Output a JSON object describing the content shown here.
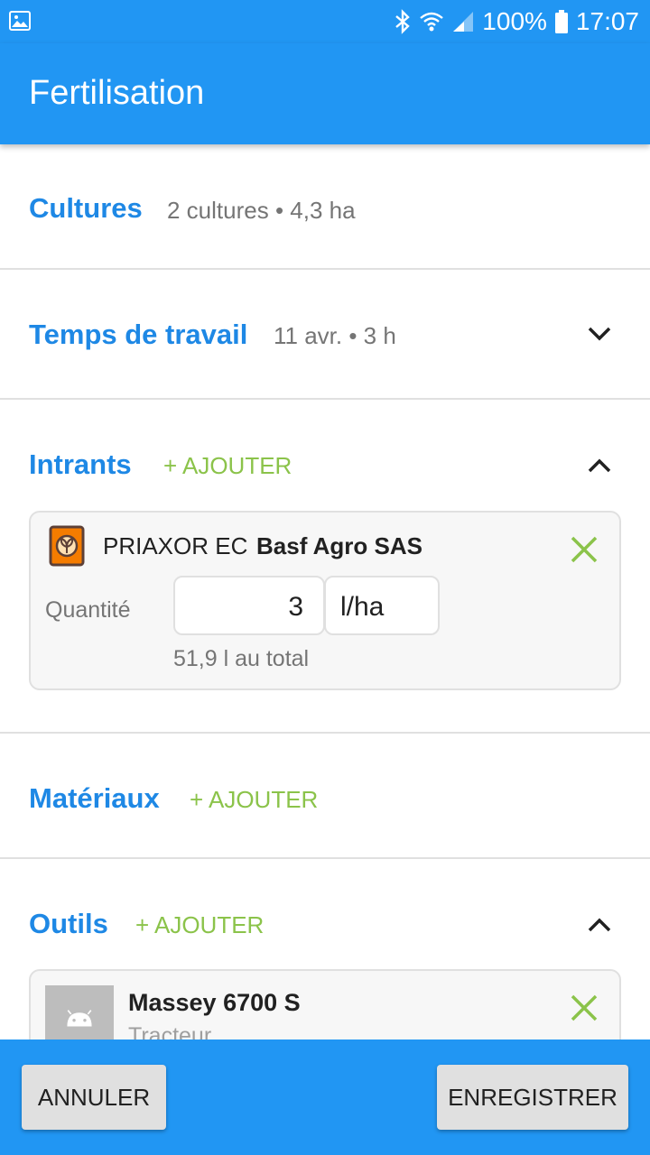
{
  "status_bar": {
    "battery": "100%",
    "time": "17:07"
  },
  "app_bar": {
    "title": "Fertilisation"
  },
  "cultures": {
    "title": "Cultures",
    "summary": "2 cultures • 4,3 ha"
  },
  "temps": {
    "title": "Temps de travail",
    "summary": "11 avr. • 3 h"
  },
  "intrants": {
    "title": "Intrants",
    "add_label": "+ AJOUTER",
    "item": {
      "name": "PRIAXOR EC",
      "supplier": "Basf Agro SAS",
      "quantity_label": "Quantité",
      "quantity_value": "3",
      "unit": "l/ha",
      "total": "51,9 l au total"
    }
  },
  "materiaux": {
    "title": "Matériaux",
    "add_label": "+ AJOUTER"
  },
  "outils": {
    "title": "Outils",
    "add_label": "+ AJOUTER",
    "item": {
      "name": "Massey 6700 S",
      "type": "Tracteur"
    }
  },
  "actions": {
    "cancel_label": "ANNULER",
    "save_label": "ENREGISTRER"
  },
  "colors": {
    "primary": "#2196f3",
    "title_blue": "#1e88e5",
    "accent_green": "#8bc34a"
  }
}
